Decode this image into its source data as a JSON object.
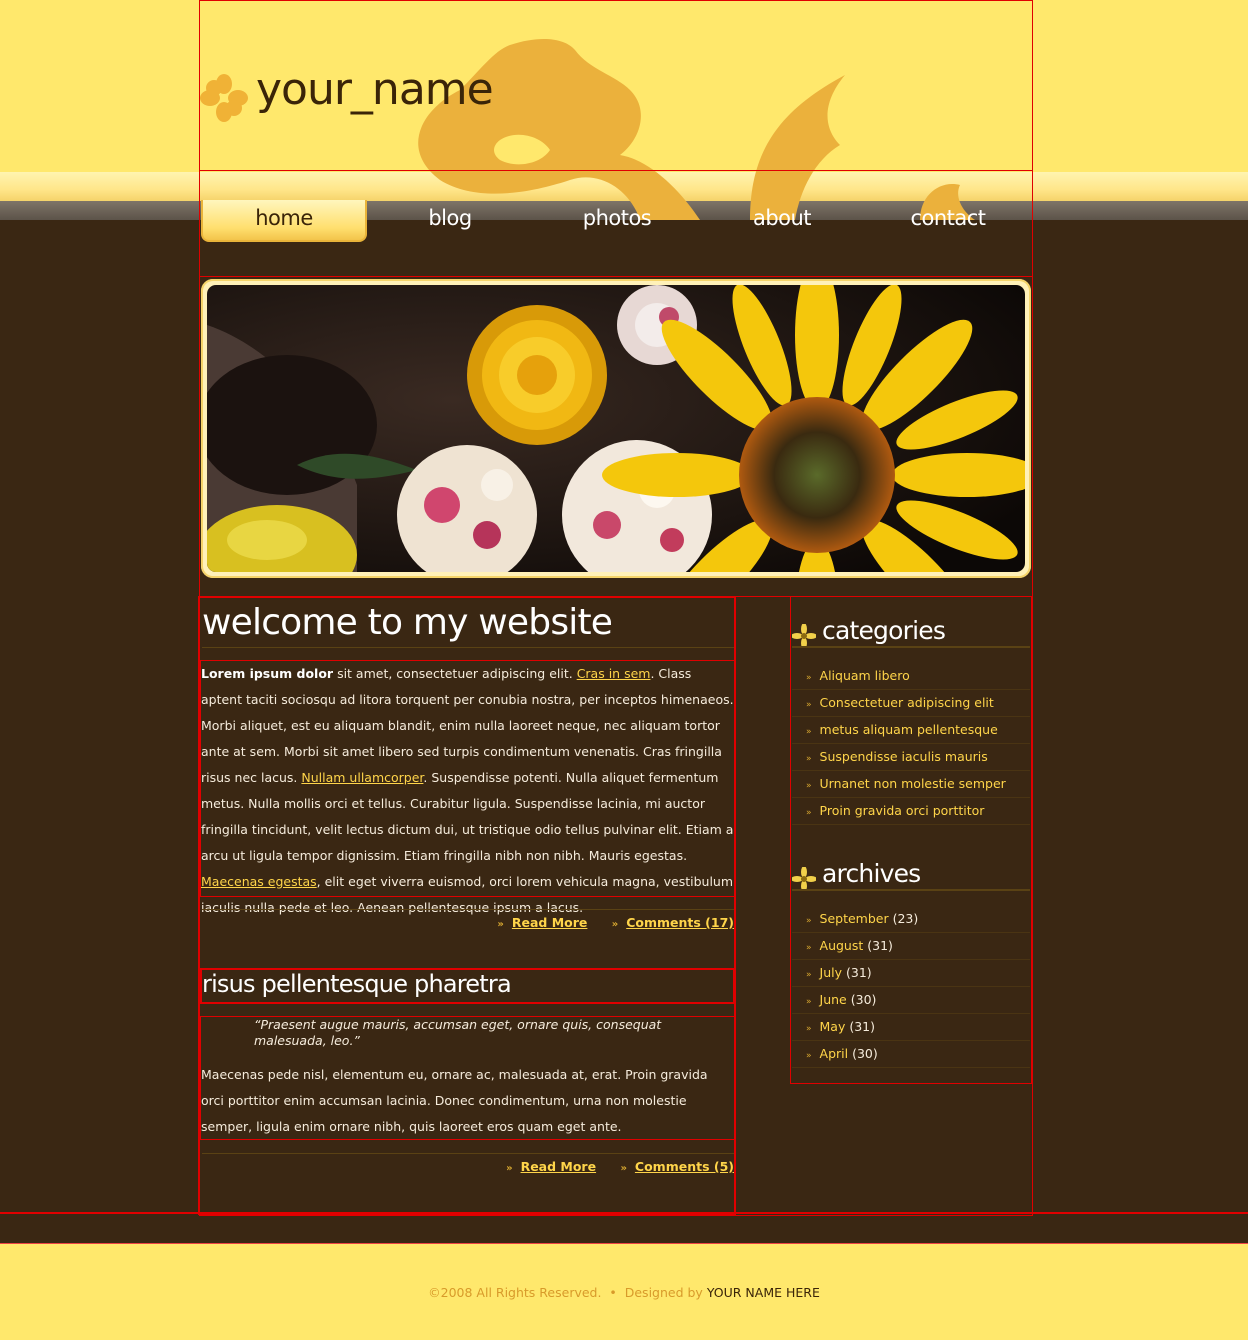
{
  "site": {
    "name": "your_name"
  },
  "nav": {
    "items": [
      {
        "label": "home",
        "active": true
      },
      {
        "label": "blog"
      },
      {
        "label": "photos"
      },
      {
        "label": "about"
      },
      {
        "label": "contact"
      }
    ]
  },
  "posts": [
    {
      "title": "welcome to my website",
      "body": {
        "bold": "Lorem ipsum dolor",
        "t1": " sit amet, consectetuer adipiscing elit. ",
        "l1": "Cras in sem",
        "t2": ". Class aptent taciti sociosqu ad litora torquent per conubia nostra, per inceptos himenaeos. Morbi aliquet, est eu aliquam blandit, enim nulla laoreet neque, nec aliquam tortor ante at sem. Morbi sit amet libero sed turpis condimentum venenatis. Cras fringilla risus nec lacus. ",
        "l2": "Nullam ullamcorper",
        "t3": ". Suspendisse potenti. Nulla aliquet fermentum metus. Nulla mollis orci et tellus. Curabitur ligula. Suspendisse lacinia, mi auctor fringilla tincidunt, velit lectus dictum dui, ut tristique odio tellus pulvinar elit. Etiam a arcu ut ligula tempor dignissim. Etiam fringilla nibh non nibh. Mauris egestas. ",
        "l3": "Maecenas egestas",
        "t4": ", elit eget viverra euismod, orci lorem vehicula magna, vestibulum iaculis nulla pede et leo. Aenean pellentesque ipsum a lacus."
      },
      "read_more": "Read More",
      "comments": "Comments (17)"
    },
    {
      "title": "risus pellentesque pharetra",
      "quote": "“Praesent augue mauris, accumsan eget, ornare quis, consequat malesuada, leo.”",
      "body_text": "Maecenas pede nisl, elementum eu, ornare ac, malesuada at, erat. Proin gravida orci porttitor enim accumsan lacinia. Donec condimentum, urna non molestie semper, ligula enim ornare nibh, quis laoreet eros quam eget ante.",
      "read_more": "Read More",
      "comments": "Comments (5)"
    }
  ],
  "sidebar": {
    "categories": {
      "title": "categories",
      "items": [
        "Aliquam libero",
        "Consectetuer adipiscing elit",
        "metus aliquam pellentesque",
        "Suspendisse iaculis mauris",
        "Urnanet non molestie semper",
        "Proin gravida orci porttitor"
      ]
    },
    "archives": {
      "title": "archives",
      "items": [
        {
          "month": "September",
          "count": "(23)"
        },
        {
          "month": "August",
          "count": "(31)"
        },
        {
          "month": "July",
          "count": "(31)"
        },
        {
          "month": "June",
          "count": "(30)"
        },
        {
          "month": "May",
          "count": "(31)"
        },
        {
          "month": "April",
          "count": "(30)"
        }
      ]
    }
  },
  "footer": {
    "copyright": "©2008 All Rights Reserved.",
    "separator": "•",
    "designed_by": "Designed by",
    "designer": "YOUR NAME HERE"
  },
  "colors": {
    "header_yellow": "#ffe86c",
    "content_brown": "#3a2713",
    "link_yellow": "#ffd54a",
    "outline_red": "#e00000"
  }
}
